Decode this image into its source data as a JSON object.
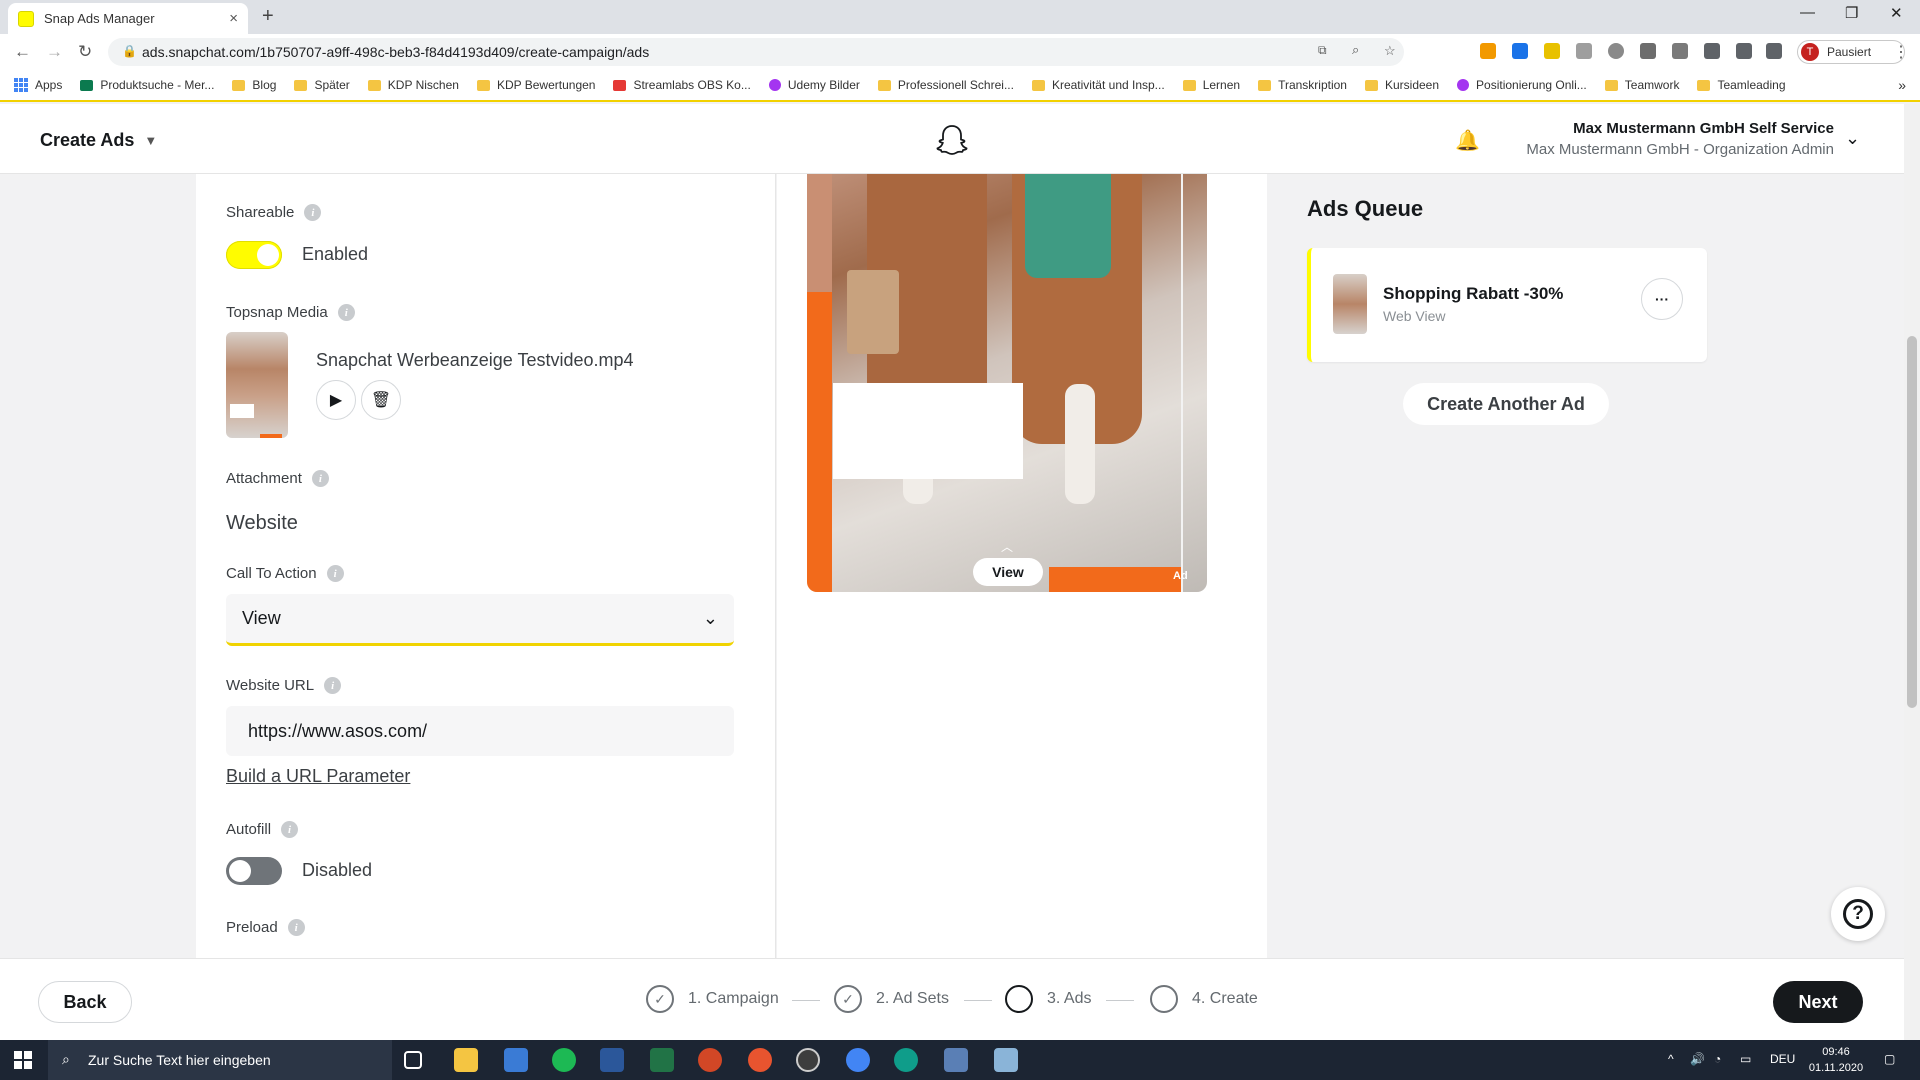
{
  "browser": {
    "tab_title": "Snap Ads Manager",
    "tab_close": "×",
    "new_tab": "+",
    "url": "ads.snapchat.com/1b750707-a9ff-498c-beb3-f84d4193d409/create-campaign/ads",
    "profile_initial": "T",
    "profile_label": "Pausiert",
    "bookmarks": [
      "Apps",
      "Produktsuche - Mer...",
      "Blog",
      "Später",
      "KDP Nischen",
      "KDP Bewertungen",
      "Streamlabs OBS Ko...",
      "Udemy Bilder",
      "Professionell Schrei...",
      "Kreativität und Insp...",
      "Lernen",
      "Transkription",
      "Kursideen",
      "Positionierung Onli...",
      "Teamwork",
      "Teamleading"
    ],
    "bookmarks_more": "»"
  },
  "header": {
    "title": "Create Ads",
    "account_name": "Max Mustermann GmbH Self Service",
    "account_role": "Max Mustermann GmbH - Organization Admin"
  },
  "form": {
    "shareable_label": "Shareable",
    "shareable_state": "Enabled",
    "topsnap_label": "Topsnap Media",
    "media_filename": "Snapchat Werbeanzeige Testvideo.mp4",
    "attachment_label": "Attachment",
    "attachment_value": "Website",
    "cta_label": "Call To Action",
    "cta_value": "View",
    "website_url_label": "Website URL",
    "website_url_value": "https://www.asos.com/",
    "url_param_link": "Build a URL Parameter",
    "autofill_label": "Autofill",
    "autofill_state": "Disabled",
    "preload_label": "Preload",
    "info_glyph": "i"
  },
  "preview": {
    "cta_button": "View",
    "ad_tag": "Ad",
    "swipe_caret": "︿"
  },
  "queue": {
    "title": "Ads Queue",
    "items": [
      {
        "name": "Shopping Rabatt -30%",
        "type": "Web View"
      }
    ],
    "more_glyph": "···",
    "create_another": "Create Another Ad"
  },
  "footer": {
    "back": "Back",
    "next": "Next",
    "steps": [
      {
        "label": "1. Campaign",
        "done": true
      },
      {
        "label": "2. Ad Sets",
        "done": true
      },
      {
        "label": "3. Ads",
        "done": false
      },
      {
        "label": "4. Create",
        "done": false
      }
    ]
  },
  "taskbar": {
    "search_placeholder": "Zur Suche Text hier eingeben",
    "language": "DEU",
    "time": "09:46",
    "date": "01.11.2020"
  },
  "colors": {
    "snap_yellow": "#FFFC00",
    "accent_orange": "#F26A1B",
    "dark": "#16191C"
  }
}
